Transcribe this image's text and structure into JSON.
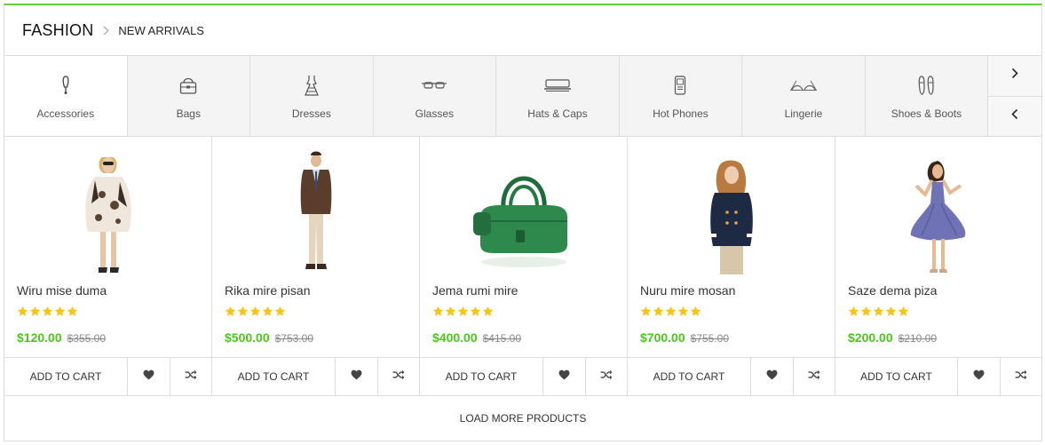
{
  "header": {
    "title": "FASHION",
    "subtitle": "NEW ARRIVALS"
  },
  "categories": [
    {
      "label": "Accessories",
      "icon": "accessories-icon",
      "active": true
    },
    {
      "label": "Bags",
      "icon": "bag-icon"
    },
    {
      "label": "Dresses",
      "icon": "dress-icon"
    },
    {
      "label": "Glasses",
      "icon": "glasses-icon"
    },
    {
      "label": "Hats & Caps",
      "icon": "hat-icon"
    },
    {
      "label": "Hot Phones",
      "icon": "phone-icon"
    },
    {
      "label": "Lingerie",
      "icon": "lingerie-icon"
    },
    {
      "label": "Shoes & Boots",
      "icon": "shoes-icon"
    }
  ],
  "products": [
    {
      "name": "Wiru mise duma",
      "price": "$120.00",
      "old_price": "$355.00",
      "rating": 5,
      "cart_label": "ADD TO CART"
    },
    {
      "name": "Rika mire pisan",
      "price": "$500.00",
      "old_price": "$753.00",
      "rating": 5,
      "cart_label": "ADD TO CART"
    },
    {
      "name": "Jema rumi mire",
      "price": "$400.00",
      "old_price": "$415.00",
      "rating": 5,
      "cart_label": "ADD TO CART"
    },
    {
      "name": "Nuru mire mosan",
      "price": "$700.00",
      "old_price": "$755.00",
      "rating": 5,
      "cart_label": "ADD TO CART"
    },
    {
      "name": "Saze dema piza",
      "price": "$200.00",
      "old_price": "$210.00",
      "rating": 5,
      "cart_label": "ADD TO CART"
    }
  ],
  "load_more": "LOAD MORE PRODUCTS",
  "colors": {
    "accent": "#5fd33a",
    "price": "#4cc61e",
    "star": "#f5c518"
  }
}
